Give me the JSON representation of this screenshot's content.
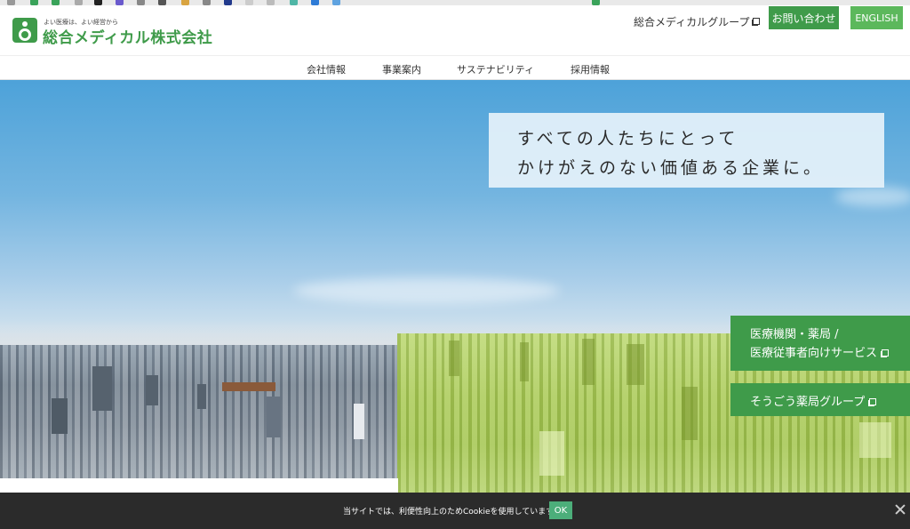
{
  "header": {
    "tagline": "よい医療は、よい経営から",
    "company_name": "総合メディカル株式会社",
    "group_link": "総合メディカルグループ",
    "contact_button": "お問い合わせ",
    "english_button": "ENGLISH"
  },
  "nav": {
    "items": [
      "会社情報",
      "事業案内",
      "サステナビリティ",
      "採用情報"
    ]
  },
  "hero": {
    "catch_line_1": "すべての人たちにとって",
    "catch_line_2": "かけがえのない価値ある企業に。",
    "side_button_1_line_1": "医療機関・薬局 /",
    "side_button_1_line_2": "医療従事者向けサービス",
    "side_button_2": "そうごう薬局グループ"
  },
  "cookie": {
    "message": "当サイトでは、利便性向上のためCookieを使用しています。",
    "ok_button": "OK"
  },
  "colors": {
    "brand_green": "#3f9b4a",
    "english_green": "#5cb85c",
    "cookie_bar": "#2b2b2b",
    "cookie_ok": "#4cae7a"
  }
}
